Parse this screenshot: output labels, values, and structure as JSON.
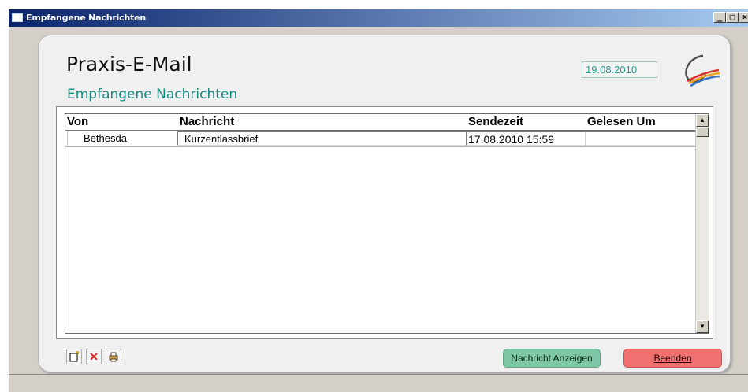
{
  "window": {
    "title": "Empfangene Nachrichten",
    "controls": {
      "minimize": "_",
      "maximize": "□",
      "close": "×"
    }
  },
  "header": {
    "app_title": "Praxis-E-Mail",
    "subtitle": "Empfangene Nachrichten",
    "date": "19.08.2010",
    "logo_icon": "swoosh-logo-icon"
  },
  "table": {
    "columns": [
      "Von",
      "Nachricht",
      "Sendezeit",
      "Gelesen Um"
    ],
    "rows": [
      {
        "von": "Bethesda",
        "nachricht": "Kurzentlassbrief",
        "sendezeit": "17.08.2010 15:59",
        "gelesen_um": ""
      }
    ]
  },
  "toolbar": {
    "new_icon": "new-document-icon",
    "delete_icon": "delete-x-icon",
    "attach_icon": "print-icon"
  },
  "buttons": {
    "show_message": "Nachricht Anzeigen",
    "exit": "Beenden"
  },
  "colors": {
    "title_gradient_start": "#0a246a",
    "subtitle": "#1a8a82",
    "show_button": "#7ec7a6",
    "exit_button": "#f07070"
  }
}
